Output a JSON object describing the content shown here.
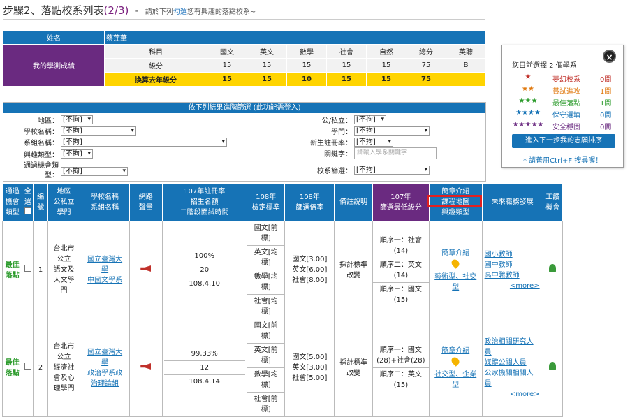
{
  "header": {
    "step": "步驟2、落點校系列表",
    "progress": "(2/3)",
    "dash": "-",
    "sub_a": "請於下列",
    "sub_hl": "勾選",
    "sub_b": "您有興趣的落點校系~"
  },
  "score": {
    "name_label": "姓名",
    "name_value": "蔡茳華",
    "row_label": "我的學測成績",
    "subject_label": "科目",
    "level_label": "級分",
    "convert_label": "換算去年級分",
    "subjects": [
      "國文",
      "英文",
      "數學",
      "社會",
      "自然",
      "總分",
      "英聽"
    ],
    "levels": [
      "15",
      "15",
      "15",
      "15",
      "15",
      "75",
      "B"
    ],
    "converted": [
      "15",
      "15",
      "10",
      "15",
      "15",
      "75",
      ""
    ]
  },
  "filter": {
    "title": "依下列結果進階篩選 (此功能需登入)",
    "region_label": "地區：",
    "region_value": "[不拘]",
    "school_label": "學校名稱：",
    "school_value": "[不拘]",
    "dept_label": "系組名稱：",
    "dept_value": "[不拘]",
    "interest_label": "興趣類型：",
    "interest_value": "[不拘]",
    "pass_label_a": "通過機會類",
    "pass_label_b": "型：",
    "pass_value": "[不拘]",
    "public_label": "公/私立：",
    "public_value": "[不拘]",
    "field_label": "學門：",
    "field_value": "[不拘]",
    "newrate_label": "新生註冊率：",
    "newrate_value": "[不拘]",
    "keyword_label": "關鍵字：",
    "keyword_placeholder": "請輸入學系關鍵字",
    "screen_label": "校系篩選：",
    "screen_value": "[不拘]"
  },
  "side": {
    "close": "×",
    "status": "您目前選擇 2 個學系",
    "levels": [
      {
        "stars": "★",
        "name": "夢幻校系",
        "count": "0間",
        "star_color": "#c0302a",
        "name_color": "#c0302a"
      },
      {
        "stars": "★★",
        "name": "嘗試進攻",
        "count": "1間",
        "star_color": "#e07a10",
        "name_color": "#e07a10"
      },
      {
        "stars": "★★★",
        "name": "最佳落點",
        "count": "1間",
        "star_color": "#2a9a2a",
        "name_color": "#2a9a2a"
      },
      {
        "stars": "★★★★",
        "name": "保守選填",
        "count": "0間",
        "star_color": "#1673b6",
        "name_color": "#1673b6"
      },
      {
        "stars": "★★★★★",
        "name": "安全穩固",
        "count": "0間",
        "star_color": "#6a2a80",
        "name_color": "#6a2a80"
      }
    ],
    "next_button": "進入下一步我的志願排序",
    "hint": "* 請善用Ctrl+F 搜尋喔！"
  },
  "table": {
    "headers": {
      "pass_type": [
        "通過",
        "機會",
        "類型"
      ],
      "select_all": "全選",
      "no": [
        "編",
        "號"
      ],
      "region": [
        "地區",
        "公私立",
        "學門"
      ],
      "school": [
        "學校名稱",
        "系組名稱"
      ],
      "audio": [
        "網路",
        "聲量"
      ],
      "rate": [
        "107年註冊率",
        "招生名額",
        "二階段面試時間"
      ],
      "check": [
        "108年",
        "檢定標準"
      ],
      "screen": [
        "108年",
        "篩選倍率"
      ],
      "note": "備註說明",
      "min": [
        "107年",
        "篩選最低級分"
      ],
      "intro": [
        "簡章介紹",
        "課程地圖",
        "興趣類型"
      ],
      "career": "未來職務發展",
      "work": [
        "工讀",
        "機會"
      ]
    },
    "rows": [
      {
        "pass": "最佳\n落點",
        "no": "1",
        "region": "台北市\n公立\n語文及\n人文學\n門",
        "school": "國立臺灣大\n學",
        "dept": "中國文學系",
        "rate": "100%",
        "quota": "20",
        "date": "108.4.10",
        "checks": [
          "國文[前\n標]",
          "英文[均\n標]",
          "數學[均\n標]",
          "社會[均\n標]"
        ],
        "screens": "國文[3.00]\n英文[6.00]\n社會[8.00]",
        "note": "採計標準\n改變",
        "mins": [
          "順序一：社會\n(14)",
          "順序二：英文\n(14)",
          "順序三：國文\n(15)"
        ],
        "intro": "簡章介紹",
        "types": "藝術型、社交\n型",
        "careers": [
          "國小教師",
          "國中教師",
          "高中職教師"
        ],
        "more": "<more>"
      },
      {
        "pass": "最佳\n落點",
        "no": "2",
        "region": "台北市\n公立\n經濟社\n會及心\n理學門",
        "school": "國立臺灣大\n學",
        "dept": "政治學系政\n治理論組",
        "rate": "99.33%",
        "quota": "12",
        "date": "108.4.14",
        "checks": [
          "國文[前\n標]",
          "英文[前\n標]",
          "數學[均\n標]",
          "社會[前\n標]"
        ],
        "screens": "國文[5.00]\n英文[3.00]\n社會[5.00]",
        "note": "採計標準\n改變",
        "mins": [
          "順序一：國文\n(28)+社會(28)",
          "順序二：英文\n(15)"
        ],
        "intro": "簡章介紹",
        "types": "社交型、企業\n型",
        "careers": [
          "政治相關研究人\n員",
          "媒體公關人員",
          "公家機關相關人\n員"
        ],
        "more": "<more>"
      }
    ]
  }
}
